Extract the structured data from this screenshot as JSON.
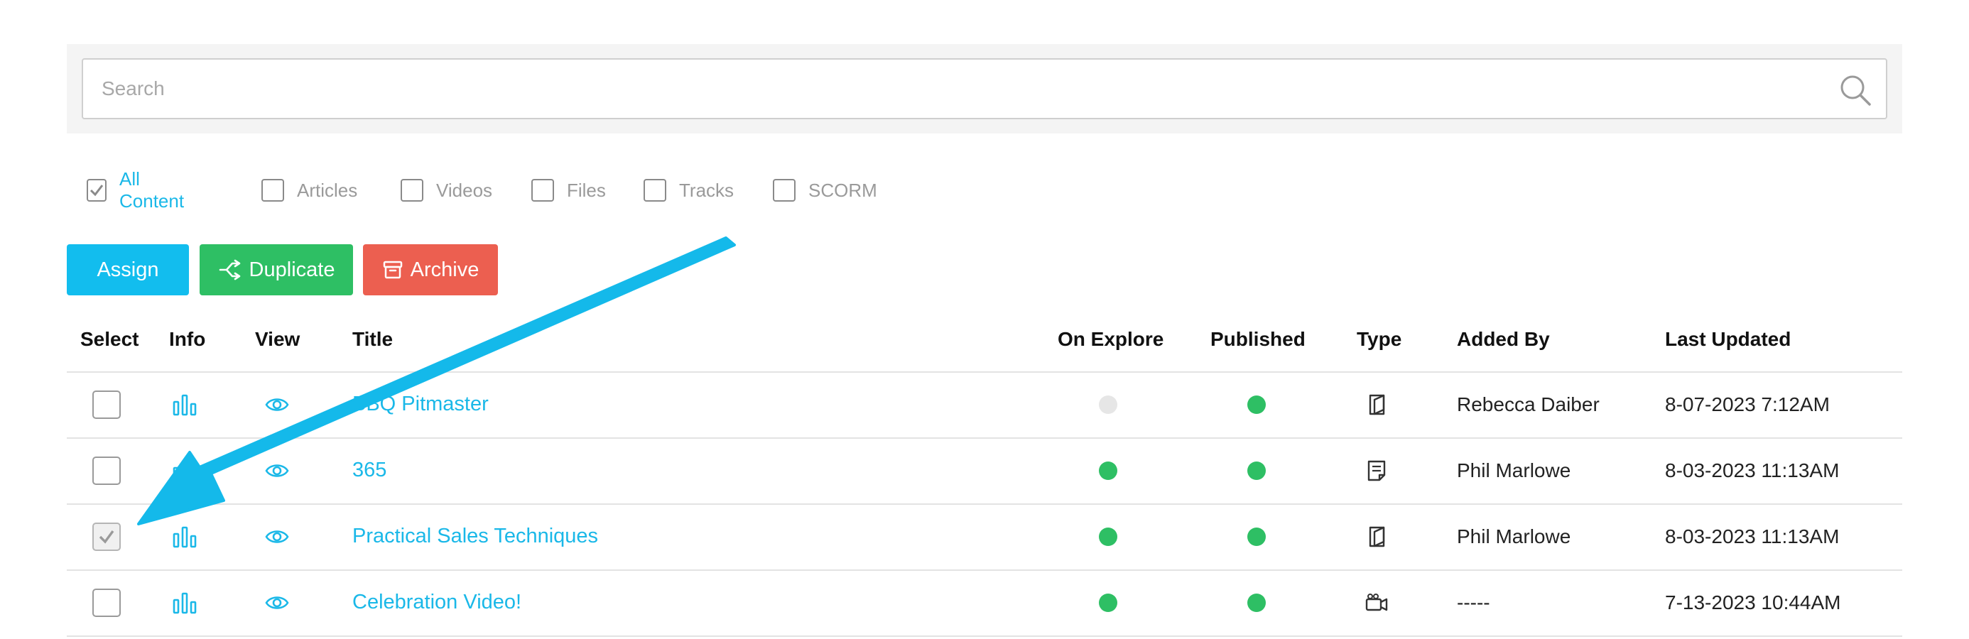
{
  "search": {
    "placeholder": "Search",
    "value": ""
  },
  "filters": [
    {
      "label": "All Content",
      "checked": true
    },
    {
      "label": "Articles",
      "checked": false
    },
    {
      "label": "Videos",
      "checked": false
    },
    {
      "label": "Files",
      "checked": false
    },
    {
      "label": "Tracks",
      "checked": false
    },
    {
      "label": "SCORM",
      "checked": false
    }
  ],
  "toolbar": {
    "assign_label": "Assign",
    "duplicate_label": "Duplicate",
    "archive_label": "Archive"
  },
  "table": {
    "headers": {
      "select": "Select",
      "info": "Info",
      "view": "View",
      "title": "Title",
      "on_explore": "On Explore",
      "published": "Published",
      "type": "Type",
      "added_by": "Added By",
      "last_updated": "Last Updated"
    },
    "rows": [
      {
        "selected": false,
        "title": "BBQ Pitmaster",
        "on_explore": false,
        "published": true,
        "type_icon": "file-icon",
        "added_by": "Rebecca Daiber",
        "last_updated": "8-07-2023 7:12AM"
      },
      {
        "selected": false,
        "title": "365",
        "on_explore": true,
        "published": true,
        "type_icon": "article-icon",
        "added_by": "Phil Marlowe",
        "last_updated": "8-03-2023 11:13AM"
      },
      {
        "selected": true,
        "title": "Practical Sales Techniques",
        "on_explore": true,
        "published": true,
        "type_icon": "file-icon",
        "added_by": "Phil Marlowe",
        "last_updated": "8-03-2023 11:13AM"
      },
      {
        "selected": false,
        "title": "Celebration Video!",
        "on_explore": true,
        "published": true,
        "type_icon": "video-icon",
        "added_by": "-----",
        "last_updated": "7-13-2023 10:44AM"
      }
    ]
  },
  "colors": {
    "accent": "#1ab8e8",
    "assign": "#12bdee",
    "duplicate": "#2ebf64",
    "archive": "#ec5f50",
    "status_on": "#2ebf64",
    "status_off": "#e6e6e6",
    "annotation_arrow": "#14b9ea"
  }
}
